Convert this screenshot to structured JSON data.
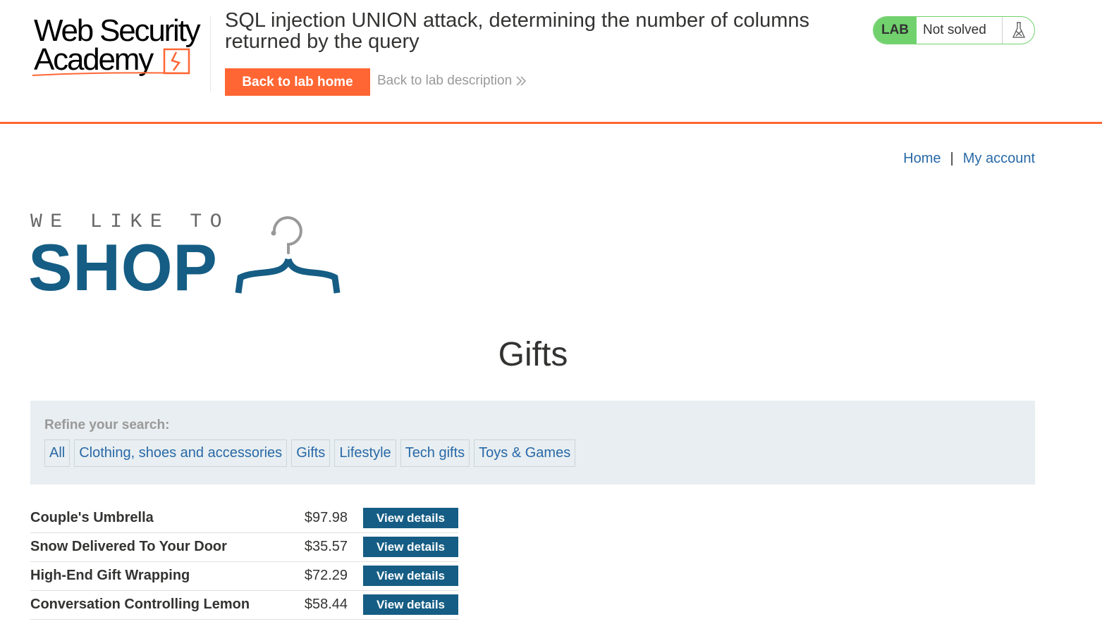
{
  "academy": {
    "logo_line1": "Web Security",
    "logo_line2": "Academy",
    "lab_title": "SQL injection UNION attack, determining the number of columns returned by the query",
    "back_to_lab_home": "Back to lab home",
    "back_to_lab_description": "Back to lab description",
    "status_badge": "LAB",
    "status_text": "Not solved",
    "status_icon": "flask-icon",
    "accent_color": "#ff6633",
    "status_color": "#70d16d"
  },
  "nav": {
    "home": "Home",
    "separator": "|",
    "my_account": "My account"
  },
  "shop_logo": {
    "tagline": "WE LIKE TO",
    "word": "SHOP",
    "icon": "hanger-icon",
    "brand_color": "#155d84"
  },
  "page": {
    "heading": "Gifts"
  },
  "filters": {
    "label": "Refine your search:",
    "items": [
      "All",
      "Clothing, shoes and accessories",
      "Gifts",
      "Lifestyle",
      "Tech gifts",
      "Toys & Games"
    ]
  },
  "products": [
    {
      "name": "Couple's Umbrella",
      "price": "$97.98",
      "action": "View details"
    },
    {
      "name": "Snow Delivered To Your Door",
      "price": "$35.57",
      "action": "View details"
    },
    {
      "name": "High-End Gift Wrapping",
      "price": "$72.29",
      "action": "View details"
    },
    {
      "name": "Conversation Controlling Lemon",
      "price": "$58.44",
      "action": "View details"
    }
  ]
}
